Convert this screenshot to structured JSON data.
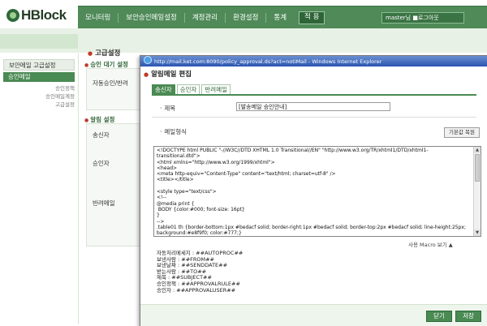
{
  "app": {
    "logo": "HBlock"
  },
  "nav": {
    "items": [
      "모니터링",
      "보안승인메일설정",
      "계정관리",
      "환경설정",
      "통계"
    ],
    "apply_label": "적 용",
    "user_label": "master님 ■로그아웃"
  },
  "sidebar": {
    "section1": "보안메일 고급설정",
    "section2": "승인메일",
    "subitems": [
      "승인정책",
      "승인메일계정",
      "고급설정"
    ]
  },
  "main": {
    "title": "고급설정",
    "section_approval": "승인 대기 설정",
    "row_auto": "자동승인/반려",
    "section_alert": "알림 설정",
    "row_sender": "송신자",
    "row_approver": "승인자",
    "row_reject": "반려메일"
  },
  "popup": {
    "window_title": "http://mail.ket.com:8090/policy_approval.ds?act=notiMail - Windows Internet Explorer",
    "header": "알림메일 편집",
    "tabs": [
      "송신자",
      "승인자",
      "반려메일"
    ],
    "subject_label": "제목",
    "subject_value": "[발송메일 승인안내]",
    "format_label": "메일형식",
    "default_button": "기본값 복원",
    "html_source": "<!DOCTYPE html PUBLIC \"-//W3C//DTD XHTML 1.0 Transitional//EN\" \"http://www.w3.org/TR/xhtml1/DTD/xhtml1-\ntransitional.dtd\">\n<html xmlns=\"http://www.w3.org/1999/xhtml\">\n<head>\n<meta http-equiv=\"Content-Type\" content=\"text/html; charset=utf-8\" />\n<title></title>\n\n<style type=\"text/css\">\n<!--\n@media print {\n BODY {color:#000; font-size: 16pt}\n}\n-->\n.table01 th {border-bottom:1px #bedacf solid; border-right:1px #bedacf solid; border-top:2px #bedacf solid; line-height:25px;\nbackground:#e8f9f0; color:#777;}\n.table01 td {border-bottom:1px #bedacf solid; border-right:1px #bedacf solid; line-height:23px;}",
    "macro_label": "사용 Macro 보기 ▲",
    "macros": "자동처리메세지 : ##AUTOPROC##\n보낸사람 : ##FROM##\n보낸날짜 : ##SENDDATE##\n받는사람 : ##TO##\n제목 : ##SUBJECT##\n승인정책 : ##APPROVALRULE##\n승인자 : ##APPROVALUSER##",
    "close_button": "닫기",
    "save_button": "저장"
  },
  "colors": {
    "nav_green": "#4f8a58",
    "accent_green": "#4a8a53",
    "ie_title": "#2b55b0"
  }
}
